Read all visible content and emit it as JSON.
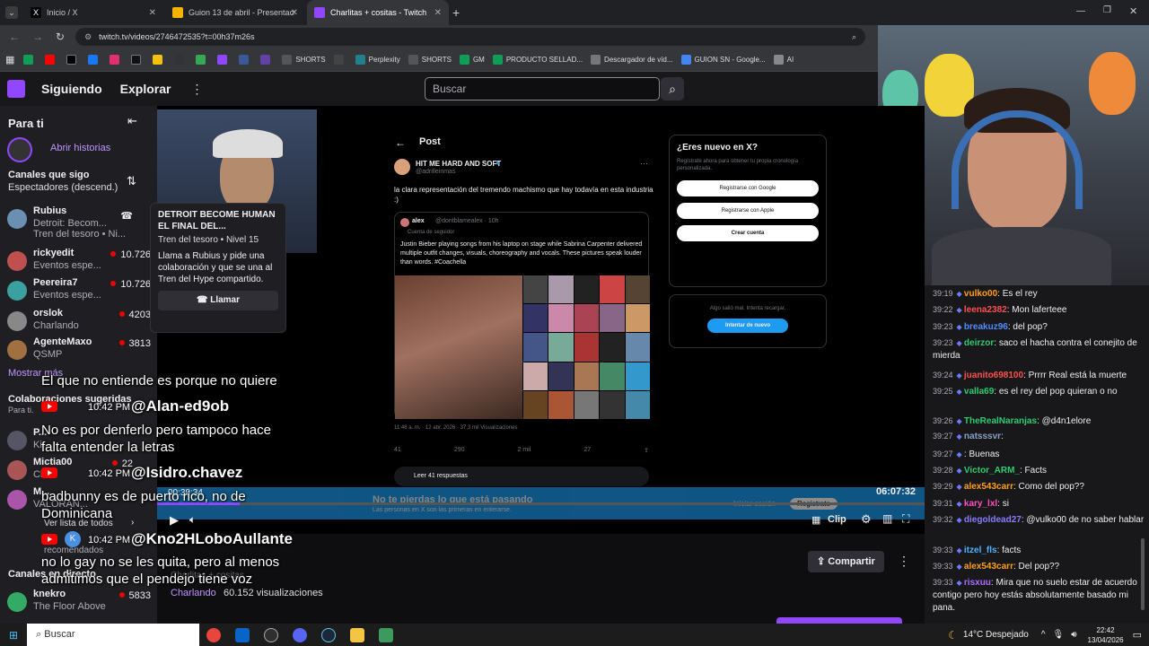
{
  "browser": {
    "tabs": [
      {
        "title": "Inicio / X",
        "icon_color": "#000000"
      },
      {
        "title": "Guion 13 de abril - Presentación",
        "icon_color": "#f4b400"
      },
      {
        "title": "Charlitas + cositas - Twitch",
        "icon_color": "#9146ff"
      }
    ],
    "url": "twitch.tv/videos/2746472535?t=00h37m26s",
    "bookmarks": [
      "SHORTS",
      "Perplexity",
      "SHORTS",
      "GM",
      "PRODUCTO SELLAD...",
      "Descargador de víd...",
      "GUION SN - Google...",
      "AI"
    ]
  },
  "twitch": {
    "nav": {
      "following": "Siguiendo",
      "browse": "Explorar"
    },
    "search_placeholder": "Buscar",
    "sidebar": {
      "for_you": "Para ti",
      "open_stories": "Abrir historias",
      "followed_title": "Canales que sigo",
      "sort_label": "Espectadores (descend.)",
      "channels": [
        {
          "name": "Rubius",
          "game": "Detroit: Becom...",
          "extra": "Tren del tesoro • Ni...",
          "viewers": "",
          "color": "#6b8fb3"
        },
        {
          "name": "rickyedit",
          "game": "Eventos espe...",
          "viewers": "10.726",
          "color": "#c05050"
        },
        {
          "name": "Peereira7",
          "game": "Eventos espe...",
          "viewers": "10.726",
          "color": "#3aa0a0"
        },
        {
          "name": "orslok",
          "game": "Charlando",
          "viewers": "4203",
          "color": "#888888"
        },
        {
          "name": "AgenteMaxo",
          "game": "QSMP",
          "viewers": "3813",
          "color": "#a07040"
        }
      ],
      "show_more": "Mostrar más",
      "collab_title": "Colaboraciones sugeridas",
      "collab_sub": "Para ti.",
      "mid_channels": [
        {
          "name": "P...",
          "game": "Ki...",
          "viewers": ""
        },
        {
          "name": "Mictia00",
          "game": "Ch...",
          "viewers": "22"
        },
        {
          "name": "M...",
          "game": "VALORAN...",
          "viewers": ""
        }
      ],
      "see_all": "Ver lista de todos",
      "recommended_sub": "recomendados",
      "live_title": "Canales en directo",
      "live_channels": [
        {
          "name": "knekro",
          "game": "The Floor Above",
          "viewers": "5833"
        }
      ]
    },
    "hype_popup": {
      "title": "DETROIT BECOME HUMAN EL FINAL DEL...",
      "train": "Tren del tesoro • Nivel 15",
      "desc": "Llama a Rubius y pide una colaboración y que se una al Tren del Hype compartido.",
      "call_button": "Llamar"
    },
    "player": {
      "elapsed": "00:39:34",
      "duration": "06:07:32",
      "clip": "Clip",
      "progress": 0.108
    },
    "below_player": {
      "share": "Compartir",
      "category": "Charlando",
      "views": "60.152 visualizaciones",
      "title_partial": "Charlitas + cositas"
    },
    "chat": [
      {
        "time": "39:19",
        "user": "vulko00",
        "color": "#ff9f1a",
        "text": "Es el rey"
      },
      {
        "time": "39:22",
        "user": "leena2382",
        "color": "#ff4f4f",
        "text": "Mon laferteee"
      },
      {
        "time": "39:23",
        "user": "breakuz96",
        "color": "#4f8cff",
        "text": "del pop?"
      },
      {
        "time": "39:23",
        "user": "deirzor",
        "color": "#2ecc71",
        "text": "saco el hacha contra el conejito de mierda"
      },
      {
        "time": "39:24",
        "user": "juanito698100",
        "color": "#ff4f4f",
        "text": "Prrrr Real está la muerte"
      },
      {
        "time": "39:25",
        "user": "valla69",
        "color": "#2ecc71",
        "text": "es el rey del pop quieran o no"
      },
      {
        "time": "39:26",
        "user": "TheRealNaranjas",
        "color": "#2ecc71",
        "text": "@d4n1elore"
      },
      {
        "time": "39:27",
        "user": "natsssvr",
        "color": "#8aa0c8",
        "text": ""
      },
      {
        "time": "39:27",
        "user": "",
        "color": "#4f8cff",
        "text": "Buenas"
      },
      {
        "time": "39:28",
        "user": "Victor_ARM_",
        "color": "#2ecc71",
        "text": "Facts"
      },
      {
        "time": "39:29",
        "user": "alex543carr",
        "color": "#ff9f1a",
        "text": "Como del pop??"
      },
      {
        "time": "39:31",
        "user": "kary_lxl",
        "color": "#ff4fbf",
        "text": "si"
      },
      {
        "time": "39:32",
        "user": "diegoldead27",
        "color": "#8a7cff",
        "text": "@vulko00 de no saber hablar"
      },
      {
        "time": "39:33",
        "user": "itzel_fls",
        "color": "#4fb3ff",
        "text": "facts"
      },
      {
        "time": "39:33",
        "user": "alex543carr",
        "color": "#ff9f1a",
        "text": "Del pop??"
      },
      {
        "time": "39:33",
        "user": "risxuu",
        "color": "#b06cff",
        "text": "Mira que no suelo estar de acuerdo contigo pero hoy estás absolutamente basado mi pana."
      }
    ]
  },
  "x_post": {
    "header": "Post",
    "author": "HIT ME HARD AND SOFT",
    "handle": "@adrilleinmas",
    "text": "la clara representación del tremendo machismo que hay todavía en esta industria :)",
    "quote_author": "alex",
    "quote_handle": "@dontblamealex · 10h",
    "quote_badge": "Cuenta de seguidor",
    "quote_text": "Justin Bieber playing songs from his laptop on stage while Sabrina Carpenter delivered multiple outfit changes, visuals, choreography and vocals. These pictures speak louder than words. #Coachella",
    "meta": "11:46 a. m. · 12 abr. 2026 · 37,3 mil Visualizaciones",
    "stats": {
      "replies": "41",
      "reposts": "290",
      "likes": "2 mil",
      "bookmarks": "27"
    },
    "read_replies": "Leer 41 respuestas",
    "new_title": "¿Eres nuevo en X?",
    "new_desc": "Regístrate ahora para obtener tu propia cronología personalizada.",
    "google_btn": "Registrarse con Google",
    "apple_btn": "Registrarse con Apple",
    "create_btn": "Crear cuenta",
    "error_text": "Algo salió mal. Intenta recargar.",
    "retry_btn": "Intentar de nuevo",
    "banner_title": "No te pierdas lo que está pasando",
    "banner_sub": "Las personas en X son las primeras en enterarse.",
    "login": "Iniciar sesión",
    "signup": "Regístrate"
  },
  "overlays": {
    "c1_text": "El que no entiende es porque no quiere",
    "c1_handle": "@Alan-ed9ob",
    "c1_time": "10:42 PM",
    "c2_text1": "No es por denferlo pero tampoco hace",
    "c2_text2": "falta entender la letras",
    "c2_handle": "@Isidro.chavez",
    "c2_time": "10:42 PM",
    "c3_text1": "badbunny es de puerto rico, no de",
    "c3_text2": "Dominicana",
    "c3_handle": "@Kno2HLoboAullante",
    "c3_time": "10:42 PM",
    "c4_text1": "no lo gay no se les quita, pero al menos",
    "c4_text2": "admitimos que el pendejo tiene voz"
  },
  "taskbar": {
    "search": "Buscar",
    "weather": "14°C  Despejado",
    "time": "22:42",
    "date": "13/04/2026"
  }
}
